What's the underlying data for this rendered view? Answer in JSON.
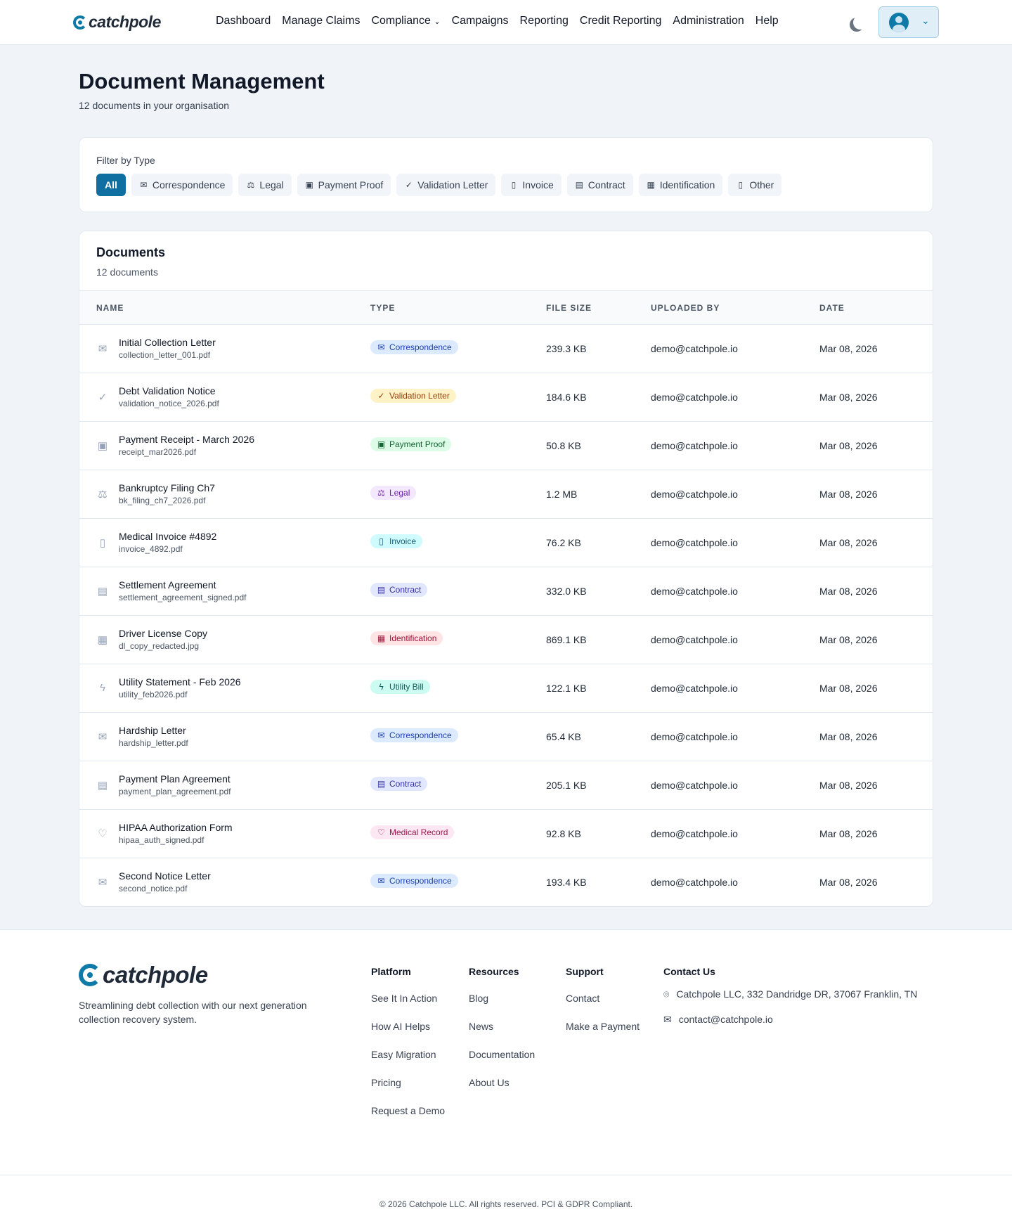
{
  "nav": {
    "logo": "catchpole",
    "items": [
      "Dashboard",
      "Manage Claims",
      "Compliance",
      "Campaigns",
      "Reporting",
      "Credit Reporting",
      "Administration",
      "Help"
    ]
  },
  "page": {
    "title": "Document Management",
    "subtitle": "12 documents in your organisation"
  },
  "filter": {
    "label": "Filter by Type",
    "chips": [
      {
        "label": "All",
        "icon": ""
      },
      {
        "label": "Correspondence",
        "icon": "✉"
      },
      {
        "label": "Legal",
        "icon": "⚖"
      },
      {
        "label": "Payment Proof",
        "icon": "▣"
      },
      {
        "label": "Validation Letter",
        "icon": "✓"
      },
      {
        "label": "Invoice",
        "icon": "▯"
      },
      {
        "label": "Contract",
        "icon": "▤"
      },
      {
        "label": "Identification",
        "icon": "▦"
      },
      {
        "label": "Other",
        "icon": "▯"
      }
    ]
  },
  "documents": {
    "title": "Documents",
    "count": "12 documents",
    "columns": [
      "NAME",
      "TYPE",
      "FILE SIZE",
      "UPLOADED BY",
      "DATE"
    ],
    "rows": [
      {
        "name": "Initial Collection Letter",
        "file": "collection_letter_001.pdf",
        "type": "Correspondence",
        "icon": "✉",
        "size": "239.3 KB",
        "by": "demo@catchpole.io",
        "date": "Mar 08, 2026",
        "bg": "#dbeafe",
        "fg": "#1e40af"
      },
      {
        "name": "Debt Validation Notice",
        "file": "validation_notice_2026.pdf",
        "type": "Validation Letter",
        "icon": "✓",
        "size": "184.6 KB",
        "by": "demo@catchpole.io",
        "date": "Mar 08, 2026",
        "bg": "#fef3c7",
        "fg": "#92400e"
      },
      {
        "name": "Payment Receipt - March 2026",
        "file": "receipt_mar2026.pdf",
        "type": "Payment Proof",
        "icon": "▣",
        "size": "50.8 KB",
        "by": "demo@catchpole.io",
        "date": "Mar 08, 2026",
        "bg": "#dcfce7",
        "fg": "#166534"
      },
      {
        "name": "Bankruptcy Filing Ch7",
        "file": "bk_filing_ch7_2026.pdf",
        "type": "Legal",
        "icon": "⚖",
        "size": "1.2 MB",
        "by": "demo@catchpole.io",
        "date": "Mar 08, 2026",
        "bg": "#f3e8ff",
        "fg": "#6b21a8"
      },
      {
        "name": "Medical Invoice #4892",
        "file": "invoice_4892.pdf",
        "type": "Invoice",
        "icon": "▯",
        "size": "76.2 KB",
        "by": "demo@catchpole.io",
        "date": "Mar 08, 2026",
        "bg": "#cffafe",
        "fg": "#155e75"
      },
      {
        "name": "Settlement Agreement",
        "file": "settlement_agreement_signed.pdf",
        "type": "Contract",
        "icon": "▤",
        "size": "332.0 KB",
        "by": "demo@catchpole.io",
        "date": "Mar 08, 2026",
        "bg": "#e0e7ff",
        "fg": "#3730a3"
      },
      {
        "name": "Driver License Copy",
        "file": "dl_copy_redacted.jpg",
        "type": "Identification",
        "icon": "▦",
        "size": "869.1 KB",
        "by": "demo@catchpole.io",
        "date": "Mar 08, 2026",
        "bg": "#ffe4e6",
        "fg": "#9f1239"
      },
      {
        "name": "Utility Statement - Feb 2026",
        "file": "utility_feb2026.pdf",
        "type": "Utility Bill",
        "icon": "ϟ",
        "size": "122.1 KB",
        "by": "demo@catchpole.io",
        "date": "Mar 08, 2026",
        "bg": "#ccfbf1",
        "fg": "#115e59"
      },
      {
        "name": "Hardship Letter",
        "file": "hardship_letter.pdf",
        "type": "Correspondence",
        "icon": "✉",
        "size": "65.4 KB",
        "by": "demo@catchpole.io",
        "date": "Mar 08, 2026",
        "bg": "#dbeafe",
        "fg": "#1e40af"
      },
      {
        "name": "Payment Plan Agreement",
        "file": "payment_plan_agreement.pdf",
        "type": "Contract",
        "icon": "▤",
        "size": "205.1 KB",
        "by": "demo@catchpole.io",
        "date": "Mar 08, 2026",
        "bg": "#e0e7ff",
        "fg": "#3730a3"
      },
      {
        "name": "HIPAA Authorization Form",
        "file": "hipaa_auth_signed.pdf",
        "type": "Medical Record",
        "icon": "♡",
        "size": "92.8 KB",
        "by": "demo@catchpole.io",
        "date": "Mar 08, 2026",
        "bg": "#fce7f3",
        "fg": "#9d174d"
      },
      {
        "name": "Second Notice Letter",
        "file": "second_notice.pdf",
        "type": "Correspondence",
        "icon": "✉",
        "size": "193.4 KB",
        "by": "demo@catchpole.io",
        "date": "Mar 08, 2026",
        "bg": "#dbeafe",
        "fg": "#1e40af"
      }
    ]
  },
  "footer": {
    "logo": "catchpole",
    "tagline": "Streamlining debt collection with our next generation collection recovery system.",
    "columns": [
      {
        "title": "Platform",
        "links": [
          "See It In Action",
          "How AI Helps",
          "Easy Migration",
          "Pricing",
          "Request a Demo"
        ]
      },
      {
        "title": "Resources",
        "links": [
          "Blog",
          "News",
          "Documentation",
          "About Us"
        ]
      },
      {
        "title": "Support",
        "links": [
          "Contact",
          "Make a Payment"
        ]
      }
    ],
    "contact": {
      "title": "Contact Us",
      "address": "Catchpole LLC, 332 Dandridge DR, 37067 Franklin, TN",
      "email": "contact@catchpole.io"
    },
    "copyright": "© 2026 Catchpole LLC. All rights reserved. PCI & GDPR Compliant."
  },
  "colors": {
    "accent": "#0e6fa0"
  }
}
